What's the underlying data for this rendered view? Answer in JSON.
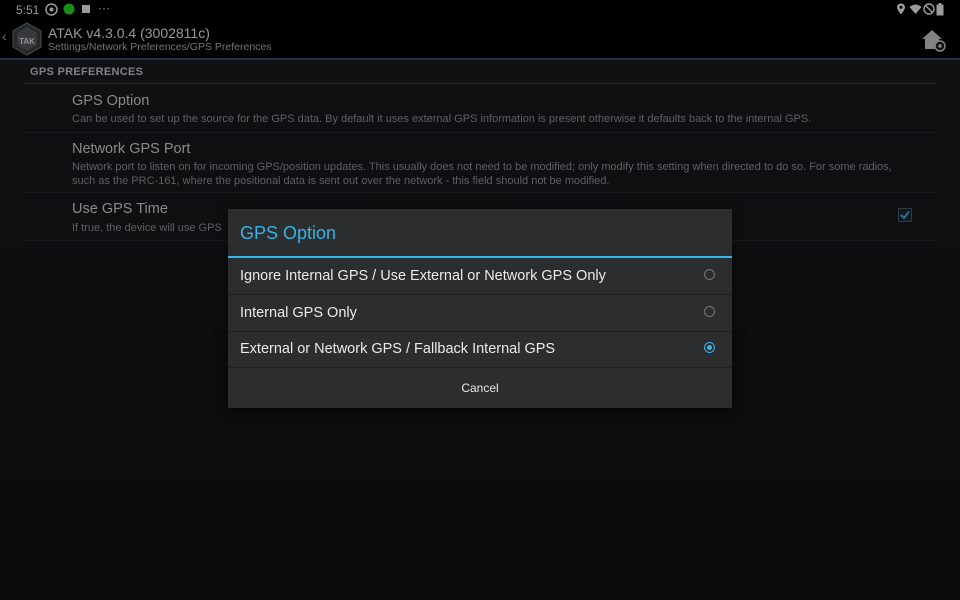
{
  "status_bar": {
    "time": "5:51",
    "more_label": "···"
  },
  "app_bar": {
    "title": "ATAK v4.3.0.4 (3002811c)",
    "breadcrumb": "Settings/Network Preferences/GPS Preferences",
    "logo_text": "TAK"
  },
  "section": {
    "header": "GPS PREFERENCES"
  },
  "preferences": [
    {
      "title": "GPS Option",
      "summary": "Can be used to set up the source for the GPS data. By default it uses external GPS information is present otherwise it defaults back to the internal GPS."
    },
    {
      "title": "Network GPS Port",
      "summary": "Network port to listen on for incoming GPS/position updates. This usually does not need to be modified; only modify this setting when directed to do so. For some radios, such as the PRC-161, where the positional data is sent out over the network - this field should not be modified."
    },
    {
      "title": "Use GPS Time",
      "summary": "If true, the device will use GPS",
      "checked": true
    }
  ],
  "dialog": {
    "title": "GPS Option",
    "options": [
      {
        "label": "Ignore Internal GPS / Use External or Network GPS Only",
        "selected": false
      },
      {
        "label": "Internal GPS Only",
        "selected": false
      },
      {
        "label": "External or Network GPS / Fallback Internal GPS",
        "selected": true
      }
    ],
    "cancel_label": "Cancel"
  },
  "colors": {
    "accent": "#33b5e5",
    "dialog_bg": "#2b2d2f",
    "status_green": "#22dd22"
  }
}
